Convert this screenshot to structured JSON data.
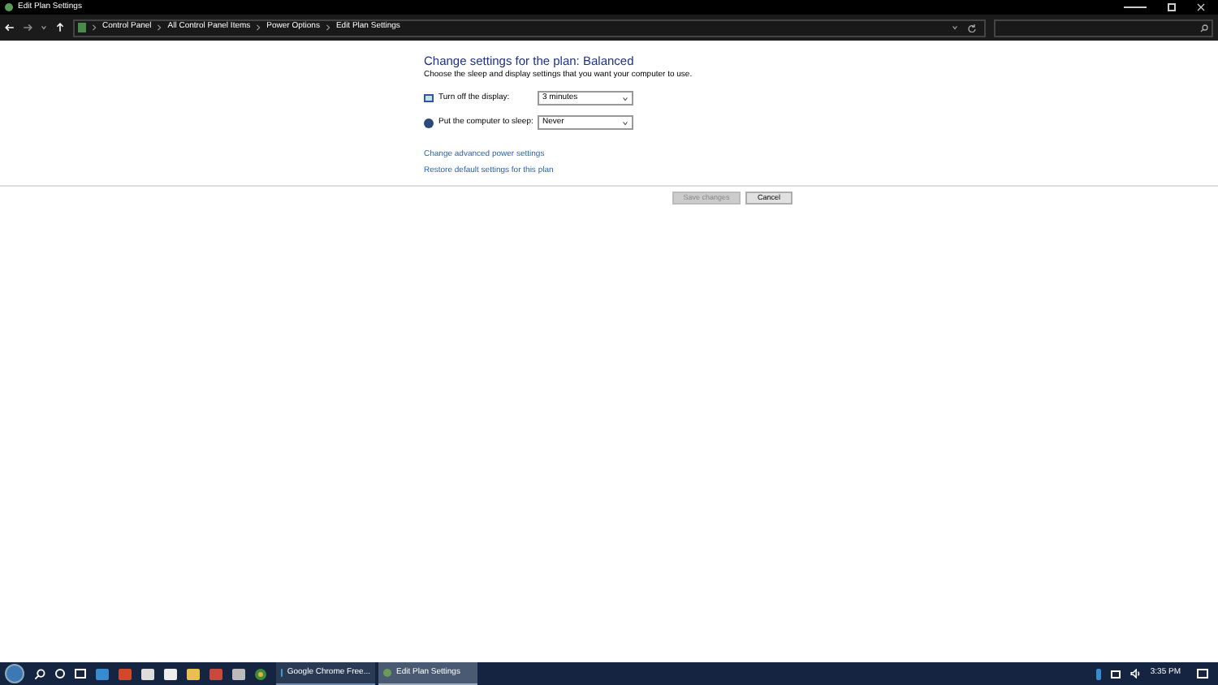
{
  "window": {
    "title": "Edit Plan Settings"
  },
  "breadcrumb": [
    "Control Panel",
    "All Control Panel Items",
    "Power Options",
    "Edit Plan Settings"
  ],
  "heading": "Change settings for the plan: Balanced",
  "description": "Choose the sleep and display settings that you want your computer to use.",
  "settings": [
    {
      "kind": "display",
      "label": "Turn off the display:",
      "value": "3 minutes"
    },
    {
      "kind": "sleep",
      "label": "Put the computer to sleep:",
      "value": "Never"
    }
  ],
  "links": [
    "Change advanced power settings",
    "Restore default settings for this plan"
  ],
  "buttons": [
    {
      "label": "Save changes",
      "disabled": true
    },
    {
      "label": "Cancel",
      "disabled": false
    }
  ],
  "taskbar": {
    "windows": [
      {
        "label": "Google Chrome Free...",
        "selected": false
      },
      {
        "label": "Edit Plan Settings",
        "selected": true
      }
    ],
    "clock": "3:35 PM"
  }
}
